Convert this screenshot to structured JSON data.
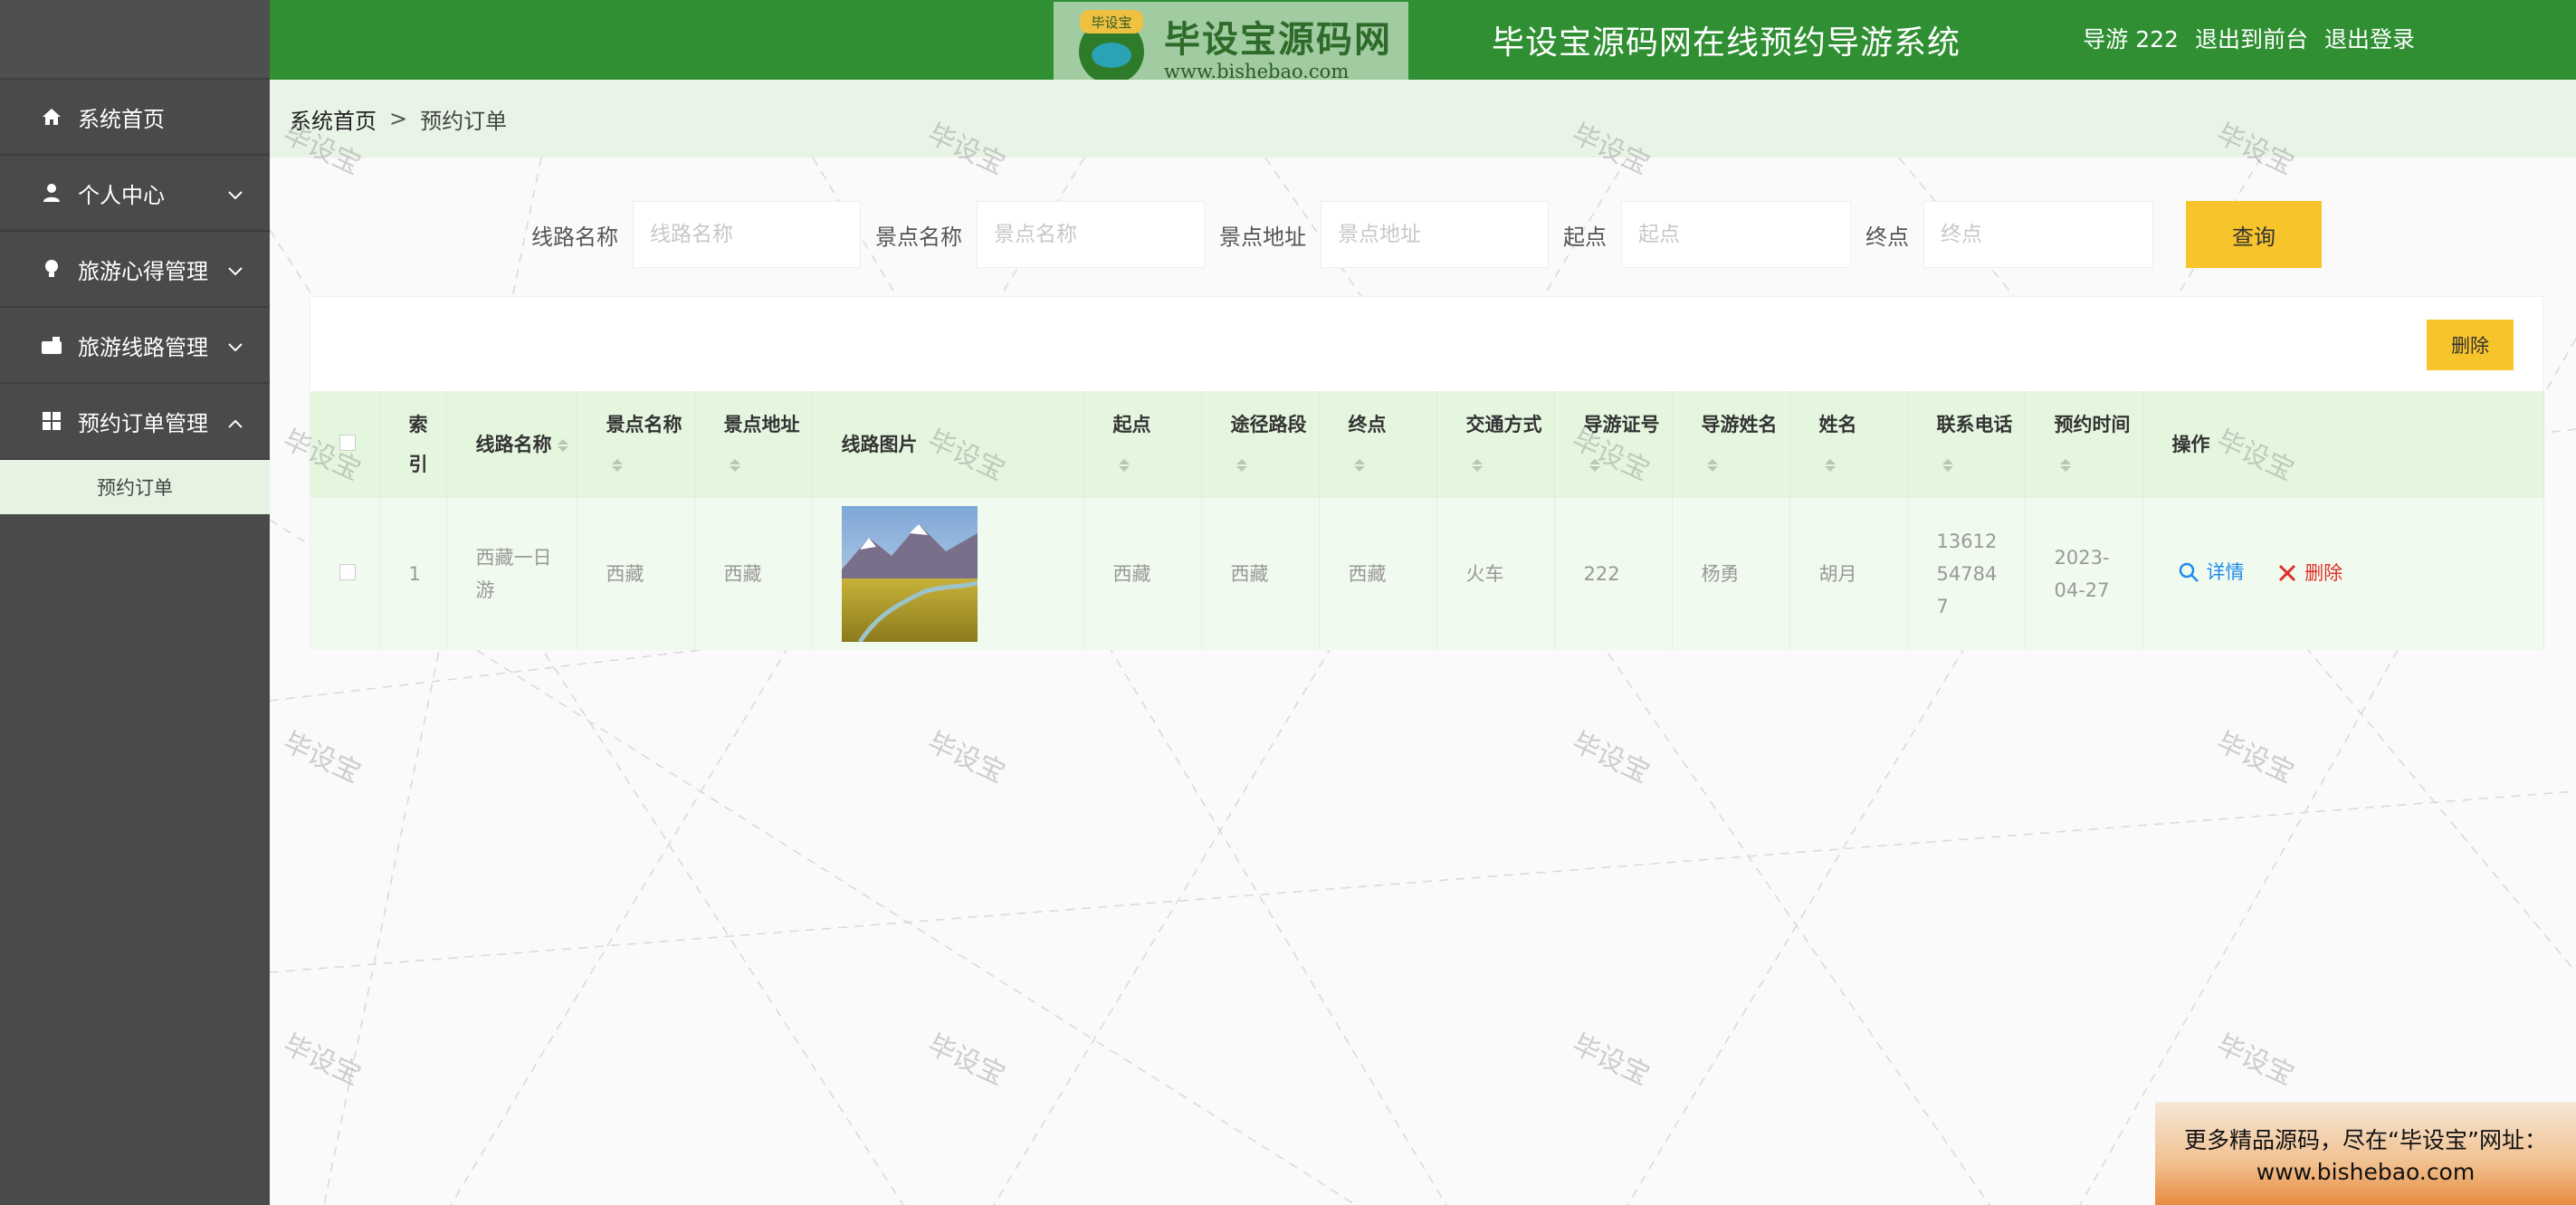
{
  "header": {
    "title": "毕设宝源码网在线预约导游系统",
    "watermark_brand": "毕设宝源码网",
    "watermark_url": "www.bishebao.com",
    "badge_text": "毕设宝",
    "user_label": "导游 222",
    "to_front_label": "退出到前台",
    "logout_label": "退出登录"
  },
  "sidebar": {
    "items": [
      {
        "label": "系统首页",
        "icon": "home-icon"
      },
      {
        "label": "个人中心",
        "icon": "user-icon"
      },
      {
        "label": "旅游心得管理",
        "icon": "bulb-icon"
      },
      {
        "label": "旅游线路管理",
        "icon": "route-icon"
      },
      {
        "label": "预约订单管理",
        "icon": "grid-icon"
      }
    ],
    "submenu": {
      "label": "预约订单"
    }
  },
  "breadcrumb": {
    "home": "系统首页",
    "separator": ">",
    "current": "预约订单"
  },
  "search": {
    "route_label": "线路名称",
    "route_placeholder": "线路名称",
    "spot_label": "景点名称",
    "spot_placeholder": "景点名称",
    "address_label": "景点地址",
    "address_placeholder": "景点地址",
    "start_label": "起点",
    "start_placeholder": "起点",
    "end_label": "终点",
    "end_placeholder": "终点",
    "query_button": "查询"
  },
  "toolbar": {
    "delete_button": "删除"
  },
  "table": {
    "headers": {
      "index": "索引",
      "route_name": "线路名称",
      "spot_name": "景点名称",
      "spot_address": "景点地址",
      "route_image": "线路图片",
      "start": "起点",
      "via": "途径路段",
      "end": "终点",
      "transport": "交通方式",
      "guide_id": "导游证号",
      "guide_name": "导游姓名",
      "name": "姓名",
      "phone": "联系电话",
      "time": "预约时间",
      "actions": "操作"
    },
    "rows": [
      {
        "index": "1",
        "route_name": "西藏一日游",
        "spot_name": "西藏",
        "spot_address": "西藏",
        "start": "西藏",
        "via": "西藏",
        "end": "西藏",
        "transport": "火车",
        "guide_id": "222",
        "guide_name": "杨勇",
        "name": "胡月",
        "phone": "13612547847",
        "time": "2023-04-27",
        "detail_label": "详情",
        "delete_label": "删除"
      }
    ]
  },
  "watermark": {
    "text": "毕设宝"
  },
  "promo": {
    "line1": "更多精品源码，尽在“毕设宝”网址：",
    "line2": "www.bishebao.com"
  },
  "colors": {
    "header": "#2f8f32",
    "sidebar": "#4a4a4a",
    "accent_button": "#f7c42b",
    "table_header": "#e5f6df",
    "table_row": "#f1faee",
    "detail_link": "#1e8cf0",
    "delete_link": "#e0302a"
  }
}
